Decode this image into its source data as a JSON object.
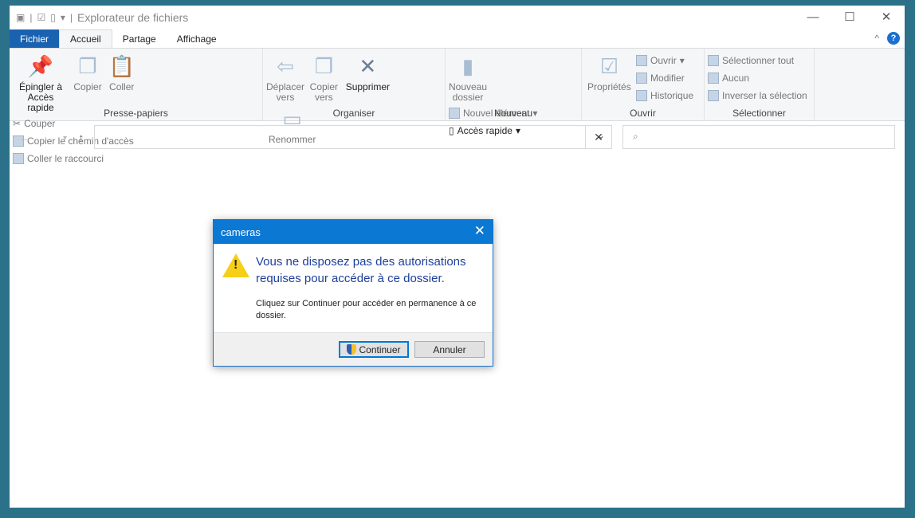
{
  "window": {
    "title": "Explorateur de fichiers"
  },
  "tabs": [
    {
      "label": "Fichier"
    },
    {
      "label": "Accueil"
    },
    {
      "label": "Partage"
    },
    {
      "label": "Affichage"
    }
  ],
  "ribbon": {
    "presse_papiers": {
      "label": "Presse-papiers",
      "epingler": "Épingler à Accès rapide",
      "copier": "Copier",
      "coller": "Coller",
      "couper": "Couper",
      "copier_chemin": "Copier le chemin d'accès",
      "coller_raccourci": "Coller le raccourci"
    },
    "organiser": {
      "label": "Organiser",
      "deplacer": "Déplacer vers",
      "copier_vers": "Copier vers",
      "supprimer": "Supprimer",
      "renommer": "Renommer"
    },
    "nouveau": {
      "label": "Nouveau",
      "nouveau_dossier": "Nouveau dossier",
      "nouvel_element": "Nouvel élément",
      "acces_rapide": "Accès rapide"
    },
    "ouvrir": {
      "label": "Ouvrir",
      "proprietes": "Propriétés",
      "ouvrir": "Ouvrir",
      "modifier": "Modifier",
      "historique": "Historique"
    },
    "selectionner": {
      "label": "Sélectionner",
      "tout": "Sélectionner tout",
      "aucun": "Aucun",
      "inverser": "Inverser la sélection"
    }
  },
  "address": {
    "value": ""
  },
  "search": {
    "placeholder": ""
  },
  "dialog": {
    "title": "cameras",
    "message": "Vous ne disposez pas des autorisations requises pour accéder à ce dossier.",
    "detail": "Cliquez sur Continuer pour accéder en permanence à ce dossier.",
    "continue": "Continuer",
    "cancel": "Annuler"
  }
}
